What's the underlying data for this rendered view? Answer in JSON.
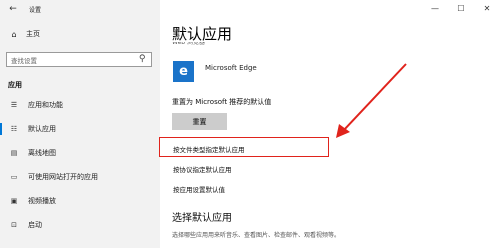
{
  "window": {
    "title": "设置",
    "back_glyph": "←",
    "minimize_glyph": "—",
    "maximize_glyph": "☐",
    "close_glyph": "✕"
  },
  "sidebar": {
    "home": {
      "label": "主页",
      "icon": "home-icon",
      "glyph": "⌂"
    },
    "search": {
      "placeholder": "查找设置",
      "icon": "search-icon",
      "glyph": "⚲"
    },
    "section": "应用",
    "items": [
      {
        "label": "应用和功能",
        "icon": "apps-list-icon",
        "glyph": "☰",
        "selected": false
      },
      {
        "label": "默认应用",
        "icon": "default-apps-icon",
        "glyph": "☷",
        "selected": true
      },
      {
        "label": "离线地图",
        "icon": "offline-map-icon",
        "glyph": "▤",
        "selected": false
      },
      {
        "label": "可使用网站打开的应用",
        "icon": "website-apps-icon",
        "glyph": "▭",
        "selected": false
      },
      {
        "label": "视频播放",
        "icon": "video-playback-icon",
        "glyph": "▣",
        "selected": false
      },
      {
        "label": "启动",
        "icon": "startup-icon",
        "glyph": "⊡",
        "selected": false
      }
    ]
  },
  "main": {
    "title": "默认应用",
    "cut_label": "Web 浏览器",
    "browser": {
      "name": "Microsoft Edge",
      "icon": "edge-icon",
      "glyph": "e"
    },
    "reset_label": "重置为 Microsoft 推荐的默认值",
    "reset_button": "重置",
    "links": [
      "按文件类型指定默认应用",
      "按协议指定默认应用",
      "按应用设置默认值"
    ],
    "choose_title": "选择默认应用",
    "choose_desc": "选择哪些应用用来听音乐、查看图片、检查邮件、观看视频等。"
  },
  "colors": {
    "accent": "#0078d7",
    "annotation": "#e0231c",
    "sidebar_bg": "#f2f2f2",
    "button_bg": "#cccccc",
    "edge_tile": "#1a73c9"
  }
}
